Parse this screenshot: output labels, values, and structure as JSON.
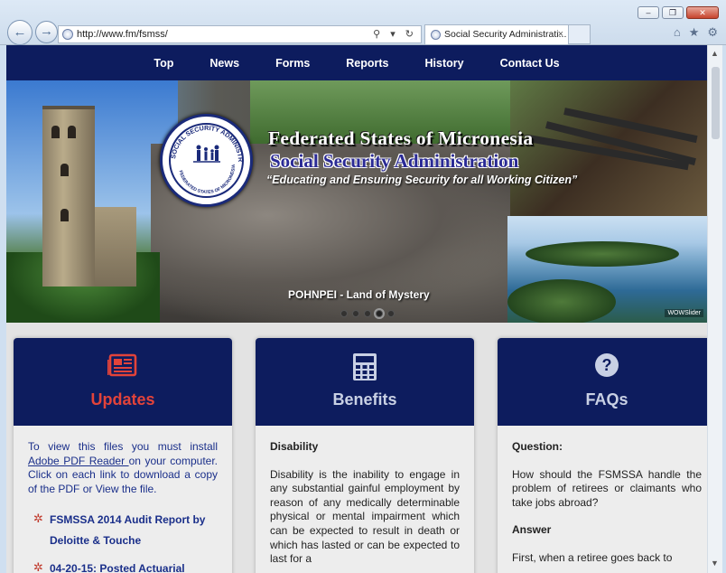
{
  "browser": {
    "url": "http://www.fm/fsmss/",
    "tab_title": "Social Security Administrati...",
    "tab_close": "×",
    "win_minimize": "–",
    "win_maximize": "❐",
    "win_close": "✕",
    "back": "←",
    "forward": "→",
    "address_controls": "⚲ ▾ ↻",
    "home": "⌂",
    "favorites": "★",
    "settings": "⚙"
  },
  "nav": {
    "items": [
      "Top",
      "News",
      "Forms",
      "Reports",
      "History",
      "Contact Us"
    ]
  },
  "banner": {
    "title": "Federated States of Micronesia",
    "subtitle": "Social Security Administration",
    "tagline": "“Educating and Ensuring Security for all Working Citizen”",
    "caption": "POHNPEI - Land of Mystery",
    "seal_text": "SOCIAL SECURITY ADMINISTRATION",
    "seal_bottom": "FEDERATED STATES OF MICRONESIA",
    "watermark": "WOWSlider"
  },
  "cards": {
    "updates": {
      "heading": "Updates",
      "intro_before": "To view this files you must install ",
      "intro_link": "Adobe PDF Reader ",
      "intro_after": "on your computer. Click on each link to download a copy of the PDF or View the file.",
      "items": [
        "FSMSSA 2014 Audit Report by Deloitte & Touche",
        "04-20-15: Posted Actuarial"
      ]
    },
    "benefits": {
      "heading": "Benefits",
      "section": "Disability",
      "text": "Disability is the inability to engage in any substantial gainful employment by reason of any medically determinable physical or mental impairment which can be expected to result in death or which has lasted or can be expected to last for a"
    },
    "faqs": {
      "heading": "FAQs",
      "q_label": "Question:",
      "question": "How should the FSMSSA handle the problem of retirees or claimants who take jobs abroad?",
      "a_label": "Answer",
      "answer": "First, when a retiree goes back to"
    }
  }
}
